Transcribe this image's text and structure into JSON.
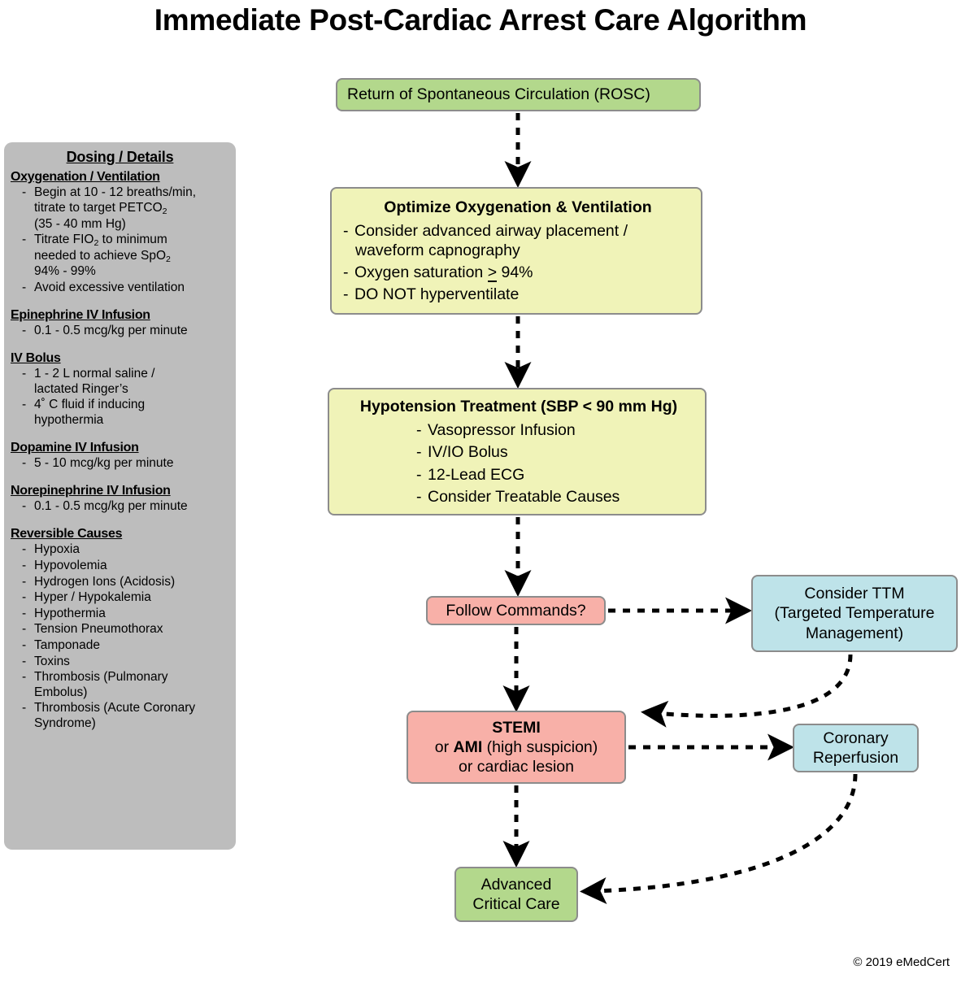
{
  "title": "Immediate Post-Cardiac Arrest Care Algorithm",
  "copyright": "© 2019 eMedCert",
  "colors": {
    "green": "#b3d88c",
    "yellow": "#f0f3b8",
    "pink": "#f8b0a8",
    "blue": "#bee3e9",
    "sidebar_gray": "#bdbdbd",
    "border_gray": "#8c8c8c"
  },
  "sidebar": {
    "title": "Dosing / Details",
    "groups": [
      {
        "heading": "Oxygenation / Ventilation",
        "items": [
          {
            "line1": "Begin at 10 - 12 breaths/min,",
            "line2": "titrate to target PETCO",
            "sub2": "2",
            "line3": "(35 - 40 mm Hg)"
          },
          {
            "line1": "Titrate FIO",
            "sub1": "2",
            "line1b": " to minimum",
            "line2": "needed to achieve SpO",
            "sub2": "2",
            "line3": "94% - 99%"
          },
          {
            "line1": "Avoid excessive ventilation"
          }
        ]
      },
      {
        "heading": "Epinephrine IV Infusion",
        "items": [
          {
            "line1": "0.1 - 0.5 mcg/kg per minute"
          }
        ]
      },
      {
        "heading": "IV Bolus",
        "items": [
          {
            "line1": "1 - 2 L normal saline /",
            "line2": "lactated Ringer’s"
          },
          {
            "line1": "4˚ C fluid if inducing",
            "line2": "hypothermia"
          }
        ]
      },
      {
        "heading": "Dopamine IV Infusion",
        "items": [
          {
            "line1": "5 - 10 mcg/kg per minute"
          }
        ]
      },
      {
        "heading": "Norepinephrine IV Infusion",
        "items": [
          {
            "line1": "0.1 - 0.5 mcg/kg per minute"
          }
        ]
      },
      {
        "heading": "Reversible Causes",
        "items": [
          {
            "line1": "Hypoxia"
          },
          {
            "line1": "Hypovolemia"
          },
          {
            "line1": "Hydrogen Ions (Acidosis)"
          },
          {
            "line1": "Hyper / Hypokalemia"
          },
          {
            "line1": "Hypothermia"
          },
          {
            "line1": "Tension Pneumothorax"
          },
          {
            "line1": "Tamponade"
          },
          {
            "line1": "Toxins"
          },
          {
            "line1": "Thrombosis (Pulmonary",
            "line2": "Embolus)"
          },
          {
            "line1": "Thrombosis (Acute Coronary",
            "line2": "Syndrome)"
          }
        ]
      }
    ],
    "bullet_dash": "-"
  },
  "flow": {
    "rosc": {
      "label": "Return of Spontaneous Circulation (ROSC)",
      "color": "green"
    },
    "oxygenation": {
      "header": "Optimize Oxygenation & Ventilation",
      "color": "yellow",
      "items": [
        {
          "line1": "Consider advanced airway placement /",
          "line2": "waveform capnography"
        },
        {
          "line1_pre": "Oxygen saturation ",
          "geq": ">",
          "line1_post": " 94%"
        },
        {
          "line1": "DO NOT hyperventilate"
        }
      ]
    },
    "hypotension": {
      "header": "Hypotension Treatment (SBP < 90 mm Hg)",
      "color": "yellow",
      "items": [
        "Vasopressor Infusion",
        "IV/IO Bolus",
        "12-Lead ECG",
        "Consider Treatable Causes"
      ]
    },
    "follow_commands": {
      "label": "Follow Commands?",
      "color": "pink"
    },
    "ttm": {
      "line1": "Consider TTM",
      "line2": "(Targeted Temperature",
      "line3": "Management)",
      "color": "blue"
    },
    "stemi": {
      "line1": "STEMI",
      "line2_pre": "or ",
      "line2_bold": "AMI",
      "line2_post": " (high suspicion)",
      "line3": "or cardiac lesion",
      "color": "pink"
    },
    "coronary_reperfusion": {
      "line1": "Coronary",
      "line2": "Reperfusion",
      "color": "blue"
    },
    "advanced_critical_care": {
      "line1": "Advanced",
      "line2": "Critical Care",
      "color": "green"
    }
  }
}
